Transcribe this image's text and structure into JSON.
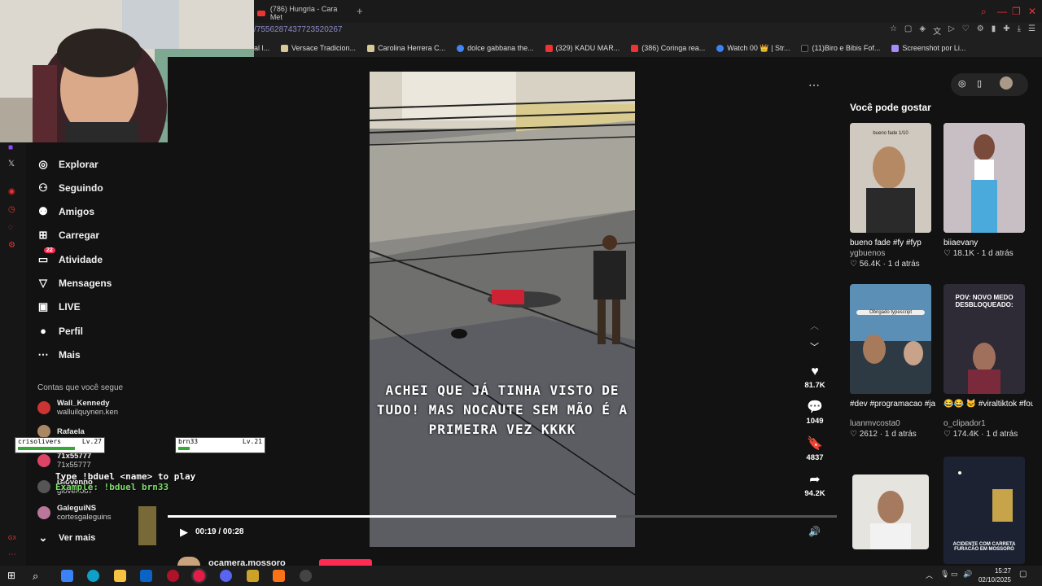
{
  "browser": {
    "tab_title": "(786) Hungria - Cara Met",
    "new_tab": "+",
    "url": "/7556287437723520267",
    "bookmarks": [
      {
        "label": "al l..."
      },
      {
        "label": "Versace Tradicion..."
      },
      {
        "label": "Carolina Herrera C..."
      },
      {
        "label": "dolce gabbana the..."
      },
      {
        "label": "(329) KADU MAR..."
      },
      {
        "label": "(386) Coringa rea..."
      },
      {
        "label": "Watch 00 👑 | Str..."
      },
      {
        "label": "(11)Biro e Bibis Fof..."
      },
      {
        "label": "Screenshot por Li..."
      }
    ]
  },
  "sidebar": {
    "nav": [
      {
        "label": "Explorar",
        "icon": "compass-icon"
      },
      {
        "label": "Seguindo",
        "icon": "following-icon"
      },
      {
        "label": "Amigos",
        "icon": "friends-icon"
      },
      {
        "label": "Carregar",
        "icon": "upload-icon"
      },
      {
        "label": "Atividade",
        "icon": "activity-icon",
        "badge": "22"
      },
      {
        "label": "Mensagens",
        "icon": "send-icon"
      },
      {
        "label": "LIVE",
        "icon": "live-icon"
      },
      {
        "label": "Perfil",
        "icon": "profile-icon"
      },
      {
        "label": "Mais",
        "icon": "more-icon"
      }
    ],
    "following_title": "Contas que você segue",
    "accounts": [
      {
        "name": "Wall_Kennedy",
        "handle": "walluilquynen.ken"
      },
      {
        "name": "Rafaela",
        "handle": ""
      },
      {
        "name": "71x55777",
        "handle": "71x55777"
      },
      {
        "name": "Giovenno",
        "handle": "giovenoo7"
      },
      {
        "name": "GaleguiNS",
        "handle": "cortesgaleguins"
      }
    ],
    "see_more": "Ver mais"
  },
  "video": {
    "caption": "ACHEI QUE JÁ TINHA VISTO DE TUDO! MAS NOCAUTE SEM MÃO É A PRIMEIRA VEZ KKKK",
    "likes": "81.7K",
    "comments": "1049",
    "saves": "4837",
    "shares": "94.2K",
    "time": "00:19 / 00:28",
    "progress": 0.67,
    "author": "ocamera.mossoro"
  },
  "game_overlay": {
    "player1": {
      "name": "crisolivers",
      "level": "Lv.27"
    },
    "player2": {
      "name": "brn33",
      "level": "Lv.21"
    },
    "hp_label": "HP",
    "instruction": "Type !bduel <name> to play",
    "example": "Example: !bduel brn33"
  },
  "recommend": {
    "title": "Você pode gostar",
    "items": [
      {
        "title": "bueno fade #fy #fyp",
        "user": "ygbuenos",
        "stats": "♡ 56.4K · 1 d atrás",
        "overlay": "bueno fade 1/10",
        "color": "#c8c2b8"
      },
      {
        "title": "",
        "user": "biiaevany",
        "stats": "♡ 18.1K · 1 d atrás",
        "overlay": "",
        "color": "#b9a9b2"
      },
      {
        "title": "#dev #programacao #java #javascript...",
        "user": "luanmvcosta0",
        "stats": "♡ 2612 · 1 d atrás",
        "overlay": "Obrigado typescript",
        "color": "#4f7ea8"
      },
      {
        "title": "😂😂 🐱 #viraltiktok #fouryou #fouryou #",
        "user": "o_clipador1",
        "stats": "♡ 174.4K · 1 d atrás",
        "overlay": "POV: NOVO MEDO DESBLOQUEADO:",
        "color": "#3a3240"
      },
      {
        "title": "",
        "user": "",
        "stats": "",
        "overlay": "",
        "color": "#e8e6e1"
      },
      {
        "title": "",
        "user": "",
        "stats": "",
        "overlay": "ACIDENTE COM CARRETA FURACÃO EM MOSSORÓ",
        "color": "#1d2230"
      }
    ]
  },
  "taskbar": {
    "time": "15:27",
    "date": "02/10/2025"
  }
}
